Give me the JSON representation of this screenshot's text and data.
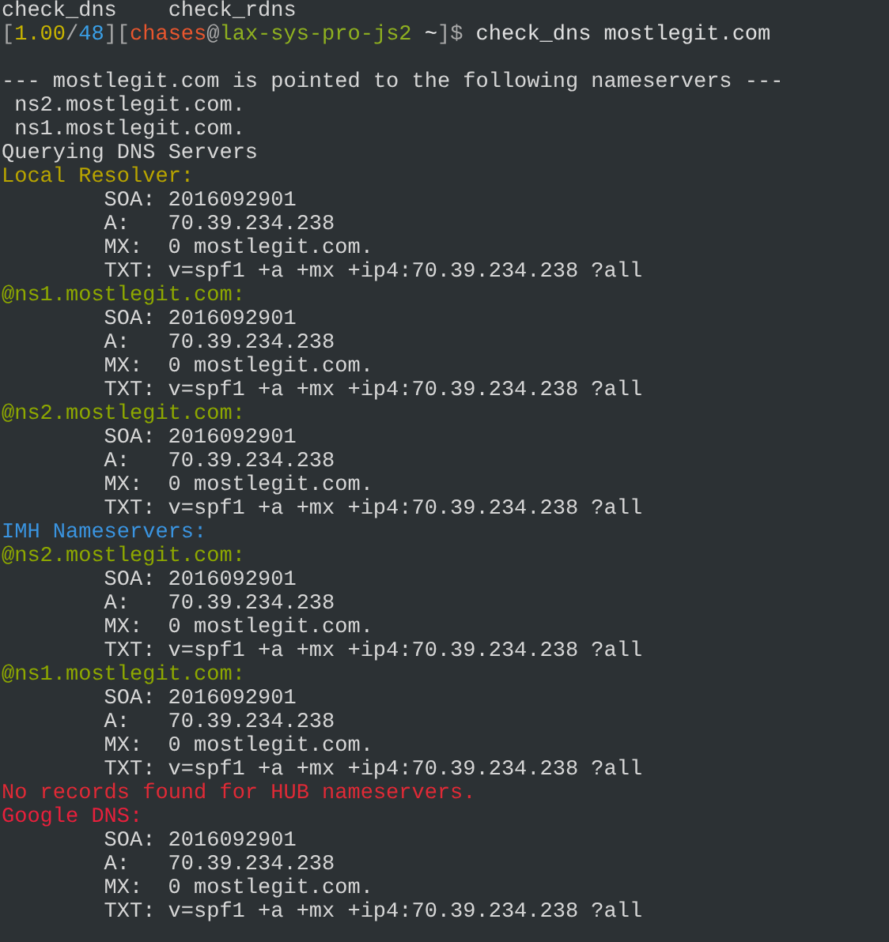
{
  "terminal": {
    "completions": [
      "check_dns",
      "check_rdns"
    ],
    "prompt": [
      {
        "text": "[",
        "color": "#a8a8a8"
      },
      {
        "text": "1.00",
        "color": "#c8b400"
      },
      {
        "text": "/",
        "color": "#a8a8a8"
      },
      {
        "text": "48",
        "color": "#3aa0e8"
      },
      {
        "text": "][",
        "color": "#a8a8a8"
      },
      {
        "text": "chases",
        "color": "#e8562e"
      },
      {
        "text": "@",
        "color": "#a8a8a8"
      },
      {
        "text": "lax-sys-pro-js2",
        "color": "#8fb020"
      },
      {
        "text": " ~",
        "color": "#f0f0f0"
      },
      {
        "text": "]$",
        "color": "#a8a8a8"
      },
      {
        "text": " check_dns mostlegit.com",
        "color": "#e0e0e0"
      }
    ],
    "lines": [
      {
        "kind": "blank"
      },
      {
        "kind": "plain",
        "text": "--- mostlegit.com is pointed to the following nameservers ---"
      },
      {
        "kind": "item",
        "text": "ns2.mostlegit.com."
      },
      {
        "kind": "item",
        "text": "ns1.mostlegit.com."
      },
      {
        "kind": "plain",
        "text": "Querying DNS Servers"
      },
      {
        "kind": "heading",
        "text": "Local Resolver:",
        "color": "#b8a400"
      },
      {
        "kind": "record",
        "text": "SOA: 2016092901"
      },
      {
        "kind": "record",
        "text": "A:   70.39.234.238"
      },
      {
        "kind": "record",
        "text": "MX:  0 mostlegit.com."
      },
      {
        "kind": "record",
        "text": "TXT: v=spf1 +a +mx +ip4:70.39.234.238 ?all"
      },
      {
        "kind": "heading",
        "text": "@ns1.mostlegit.com:",
        "color": "#8ea800"
      },
      {
        "kind": "record",
        "text": "SOA: 2016092901"
      },
      {
        "kind": "record",
        "text": "A:   70.39.234.238"
      },
      {
        "kind": "record",
        "text": "MX:  0 mostlegit.com."
      },
      {
        "kind": "record",
        "text": "TXT: v=spf1 +a +mx +ip4:70.39.234.238 ?all"
      },
      {
        "kind": "heading",
        "text": "@ns2.mostlegit.com:",
        "color": "#8ea800"
      },
      {
        "kind": "record",
        "text": "SOA: 2016092901"
      },
      {
        "kind": "record",
        "text": "A:   70.39.234.238"
      },
      {
        "kind": "record",
        "text": "MX:  0 mostlegit.com."
      },
      {
        "kind": "record",
        "text": "TXT: v=spf1 +a +mx +ip4:70.39.234.238 ?all"
      },
      {
        "kind": "heading",
        "text": "IMH Nameservers:",
        "color": "#3a94e0"
      },
      {
        "kind": "heading",
        "text": "@ns2.mostlegit.com:",
        "color": "#8ea800"
      },
      {
        "kind": "record",
        "text": "SOA: 2016092901"
      },
      {
        "kind": "record",
        "text": "A:   70.39.234.238"
      },
      {
        "kind": "record",
        "text": "MX:  0 mostlegit.com."
      },
      {
        "kind": "record",
        "text": "TXT: v=spf1 +a +mx +ip4:70.39.234.238 ?all"
      },
      {
        "kind": "heading",
        "text": "@ns1.mostlegit.com:",
        "color": "#8ea800"
      },
      {
        "kind": "record",
        "text": "SOA: 2016092901"
      },
      {
        "kind": "record",
        "text": "A:   70.39.234.238"
      },
      {
        "kind": "record",
        "text": "MX:  0 mostlegit.com."
      },
      {
        "kind": "record",
        "text": "TXT: v=spf1 +a +mx +ip4:70.39.234.238 ?all"
      },
      {
        "kind": "heading",
        "text": "No records found for HUB nameservers.",
        "color": "#e02a36"
      },
      {
        "kind": "heading",
        "text": "Google DNS:",
        "color": "#e8203c"
      },
      {
        "kind": "record",
        "text": "SOA: 2016092901"
      },
      {
        "kind": "record",
        "text": "A:   70.39.234.238"
      },
      {
        "kind": "record",
        "text": "MX:  0 mostlegit.com."
      },
      {
        "kind": "record",
        "text": "TXT: v=spf1 +a +mx +ip4:70.39.234.238 ?all"
      }
    ]
  }
}
